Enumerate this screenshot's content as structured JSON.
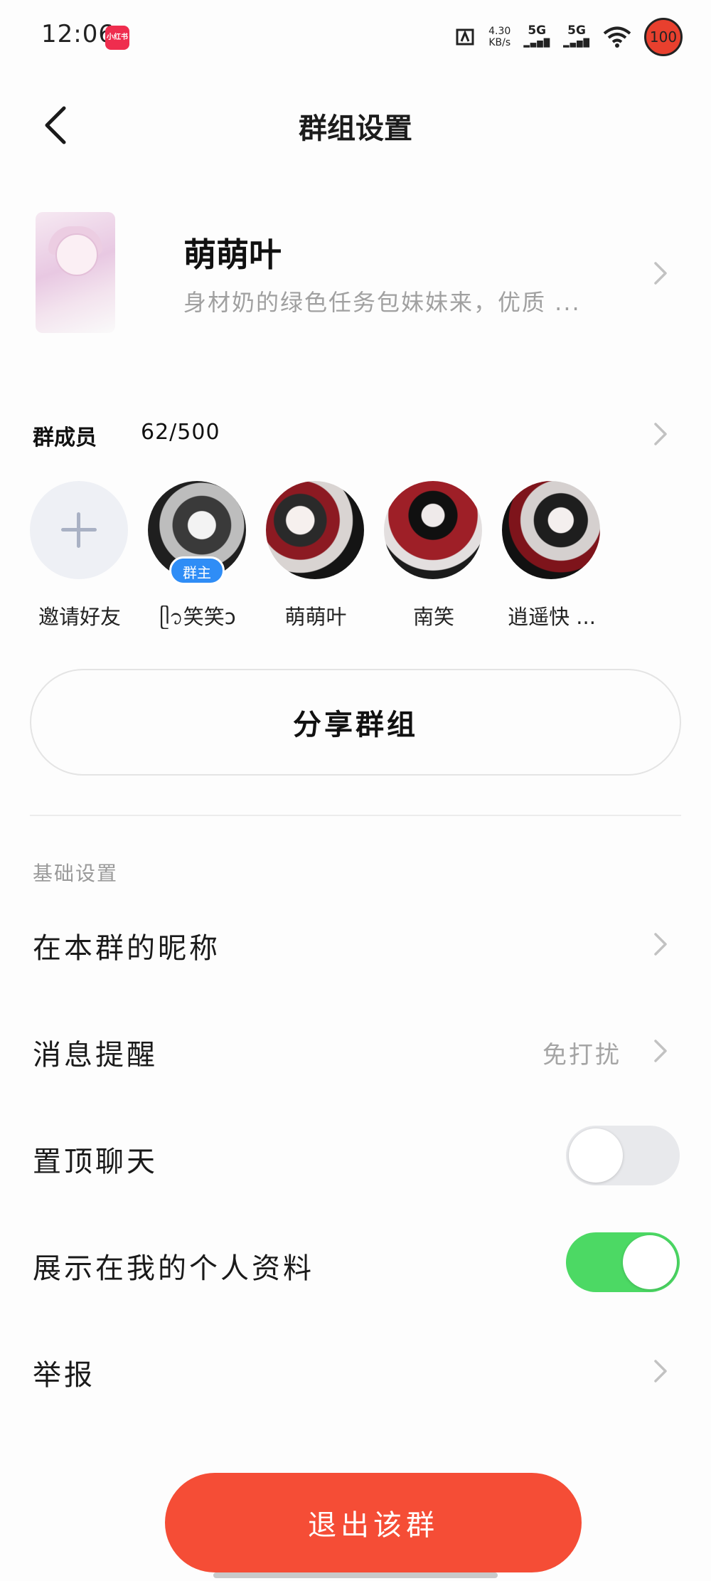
{
  "status_bar": {
    "time": "12:06",
    "app_badge": "小红书",
    "net_speed_value": "4.30",
    "net_speed_unit": "KB/s",
    "signal_1": "5G",
    "signal_2": "5G",
    "battery": "100"
  },
  "header": {
    "title": "群组设置"
  },
  "group": {
    "name": "萌萌叶",
    "description": "身材奶的绿色任务包妹妹来，优质 ..."
  },
  "members": {
    "label": "群成员",
    "count": "62/500",
    "owner_badge": "群主",
    "items": [
      {
        "name": "邀请好友"
      },
      {
        "name": "ᥫ᭡笑笑ↄ"
      },
      {
        "name": "萌萌叶"
      },
      {
        "name": "南笑"
      },
      {
        "name": "逍遥快 ..."
      }
    ]
  },
  "share_button": "分享群组",
  "settings": {
    "section_label": "基础设置",
    "rows": [
      {
        "label": "在本群的昵称"
      },
      {
        "label": "消息提醒",
        "value": "免打扰"
      },
      {
        "label": "置顶聊天",
        "toggle": false
      },
      {
        "label": "展示在我的个人资料",
        "toggle": true
      },
      {
        "label": "举报"
      }
    ]
  },
  "exit_button": "退出该群",
  "colors": {
    "exit_red": "#f54d36",
    "toggle_on": "#4cd964",
    "owner_badge_blue": "#2f8df6"
  }
}
